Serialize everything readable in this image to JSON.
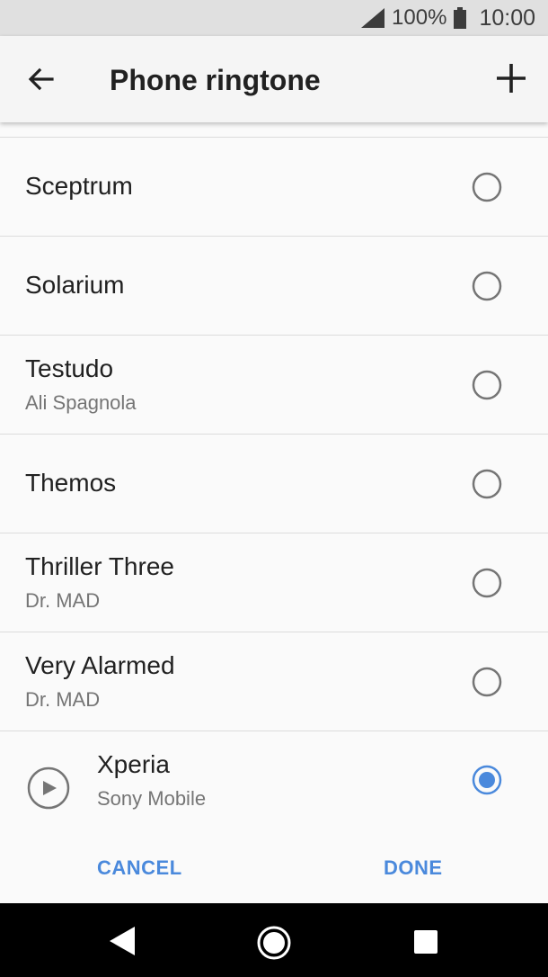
{
  "status_bar": {
    "battery_percent": "100%",
    "time": "10:00",
    "icons": [
      "signal-icon",
      "battery-icon"
    ]
  },
  "app_bar": {
    "title": "Phone ringtone",
    "icons": [
      "back-arrow-icon",
      "add-icon"
    ]
  },
  "ringtones": [
    {
      "title": "Sceptrum",
      "subtitle": "",
      "selected": false
    },
    {
      "title": "Solarium",
      "subtitle": "",
      "selected": false
    },
    {
      "title": "Testudo",
      "subtitle": "Ali Spagnola",
      "selected": false
    },
    {
      "title": "Themos",
      "subtitle": "",
      "selected": false
    },
    {
      "title": "Thriller Three",
      "subtitle": "Dr. MAD",
      "selected": false
    },
    {
      "title": "Very Alarmed",
      "subtitle": "Dr. MAD",
      "selected": false
    },
    {
      "title": "Xperia",
      "subtitle": "Sony Mobile",
      "selected": true
    }
  ],
  "buttons": {
    "cancel": "CANCEL",
    "done": "DONE"
  },
  "colors": {
    "accent": "#4a89dc",
    "status_bar": "#e0e0e0",
    "nav_bar": "#000000"
  },
  "nav_bar": {
    "icons": [
      "nav-back-icon",
      "nav-home-icon",
      "nav-recents-icon"
    ]
  }
}
